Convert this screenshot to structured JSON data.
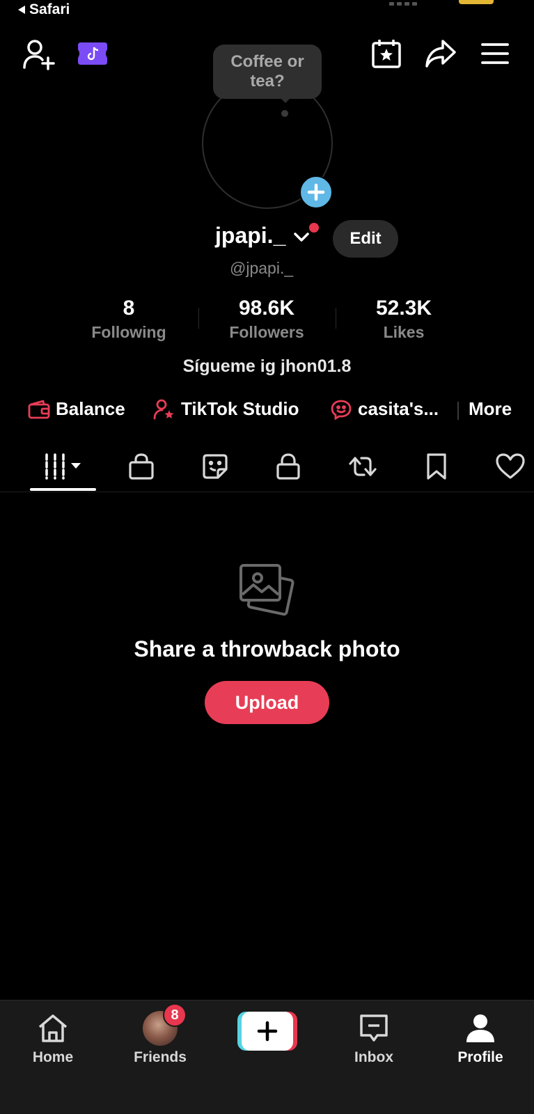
{
  "status_bar": {
    "back_app": "Safari"
  },
  "profile": {
    "speech_bubble": "Coffee or tea?",
    "username": "jpapi._",
    "handle": "@jpapi._",
    "edit_label": "Edit",
    "bio": "Sígueme ig jhon01.8"
  },
  "stats": [
    {
      "value": "8",
      "label": "Following"
    },
    {
      "value": "98.6K",
      "label": "Followers"
    },
    {
      "value": "52.3K",
      "label": "Likes"
    }
  ],
  "quick_links": {
    "balance": "Balance",
    "studio": "TikTok Studio",
    "community": "casita's...",
    "more": "More"
  },
  "empty_state": {
    "title": "Share a throwback photo",
    "button": "Upload"
  },
  "bottom_nav": {
    "home": "Home",
    "friends": "Friends",
    "friends_badge": "8",
    "inbox": "Inbox",
    "profile": "Profile"
  },
  "colors": {
    "accent_red": "#e83d56",
    "add_blue": "#5fb8e6",
    "badge_purple": "#7b4cf5",
    "muted_text": "#8a8a8a"
  },
  "icons": {
    "top_left": [
      "add-friend-icon",
      "tiktok-badge-icon"
    ],
    "top_right": [
      "calendar-star-icon",
      "share-icon",
      "menu-icon"
    ],
    "tabs": [
      "videos-grid-icon",
      "shop-bag-icon",
      "sticker-icon",
      "lock-icon",
      "repost-icon",
      "bookmark-icon",
      "heart-icon"
    ]
  }
}
